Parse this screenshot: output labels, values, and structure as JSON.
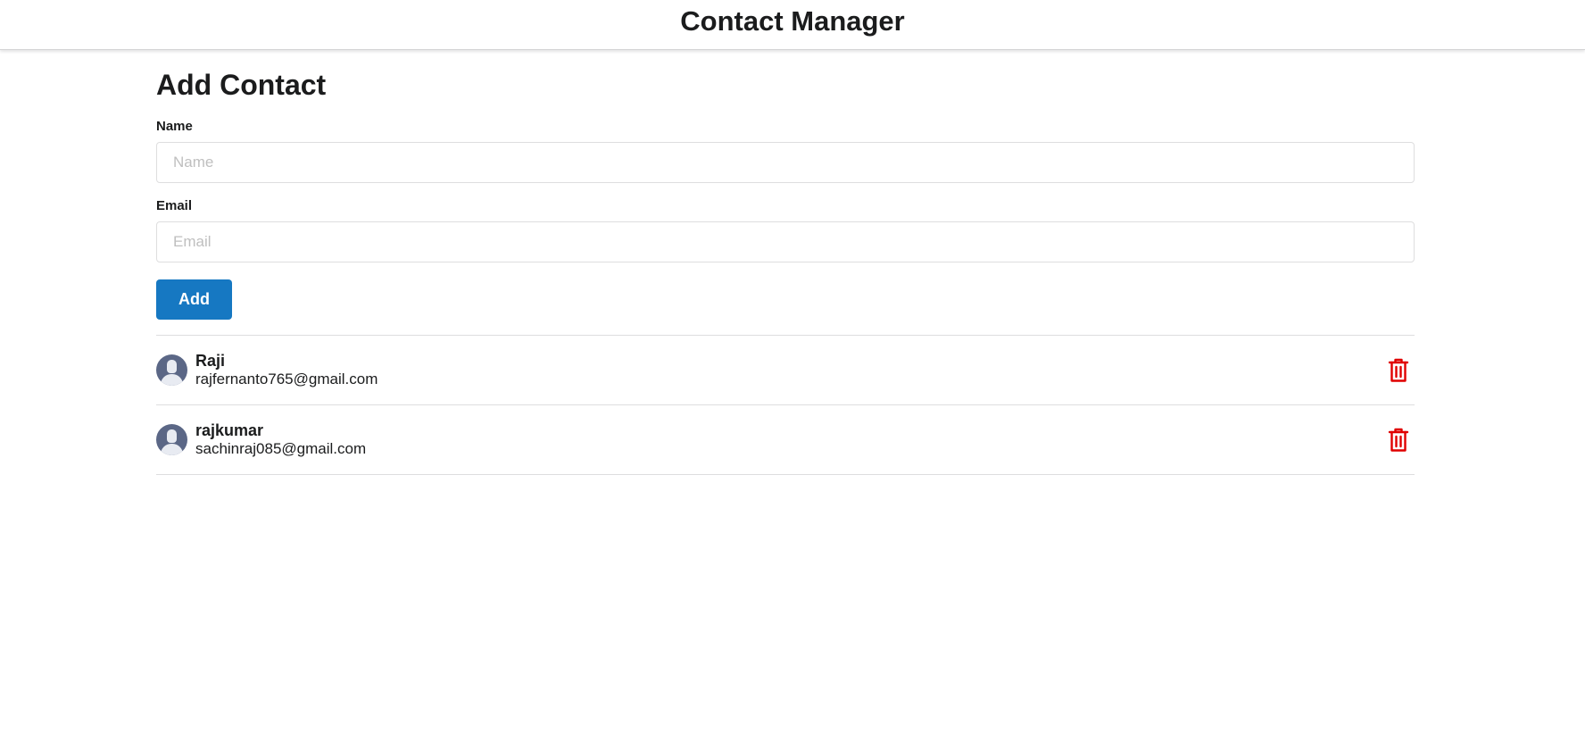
{
  "header": {
    "title": "Contact Manager"
  },
  "form": {
    "title": "Add Contact",
    "name_label": "Name",
    "name_placeholder": "Name",
    "email_label": "Email",
    "email_placeholder": "Email",
    "add_label": "Add"
  },
  "contacts": [
    {
      "name": "Raji",
      "email": "rajfernanto765@gmail.com",
      "avatar_icon": "user-avatar-icon",
      "action_icon": "trash-icon"
    },
    {
      "name": "rajkumar",
      "email": "sachinraj085@gmail.com",
      "avatar_icon": "user-avatar-icon",
      "action_icon": "trash-icon"
    }
  ],
  "colors": {
    "primary": "#1678c2",
    "delete": "#e00000",
    "avatar": "#5b6786"
  }
}
